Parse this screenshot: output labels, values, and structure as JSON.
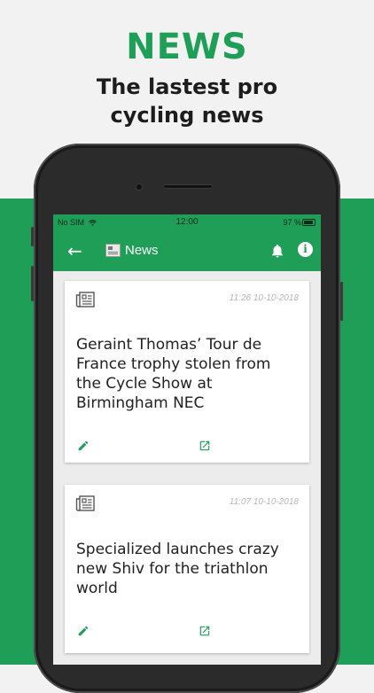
{
  "promo": {
    "title": "NEWS",
    "subtitle_line1": "The lastest pro",
    "subtitle_line2": "cycling news"
  },
  "status_bar": {
    "carrier": "No SIM",
    "time": "12:00",
    "battery": "97 %"
  },
  "app_bar": {
    "title": "News",
    "back_icon": "arrow-left-icon",
    "notifications_icon": "bell-icon",
    "info_icon": "info-icon"
  },
  "colors": {
    "brand_green": "#1e9e56",
    "timestamp_gray": "#b5b5b5"
  },
  "articles": [
    {
      "time": "11:26 10-10-2018",
      "headline": "Geraint Thomas’ Tour de France trophy stolen from the Cycle Show at Birmingham NEC"
    },
    {
      "time": "11:07 10-10-2018",
      "headline": "Specialized launches crazy new Shiv for the triathlon world"
    }
  ]
}
